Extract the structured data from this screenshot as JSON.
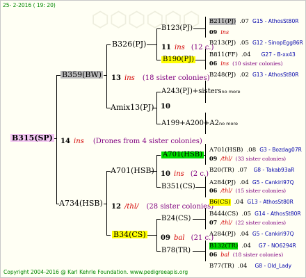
{
  "header": {
    "date": "25- 2-2016 ( 19: 20)"
  },
  "footer": {
    "text": "Copyright 2004-2016 @ Karl Kehrle Foundation.   www.pedigreeapis.org"
  },
  "root": {
    "name": "B315(SP)",
    "num": "14",
    "ins": "ins",
    "drones": "(Drones from 4 sister colonies)"
  },
  "g1": {
    "upper": {
      "name": "B359(BW)",
      "num": "13",
      "ins": "ins",
      "sis": "(18 sister colonies)"
    },
    "lower": {
      "name": "A734(HSB)",
      "num": "12",
      "ins": "/thl/",
      "sis": "(28 sister colonies)"
    }
  },
  "g2": {
    "b326": {
      "name": "B326(PJ)",
      "num": "11",
      "ins": "ins",
      "sis": "(12 c.)"
    },
    "amix": {
      "name": "Amix13(PJ)",
      "num": "10"
    },
    "a701": {
      "name": "A701(HSB)",
      "num": "10",
      "ins": "ins",
      "sis": "(2 c.)"
    },
    "b34": {
      "name": "B34(CS)",
      "num": "09",
      "ins": "bal",
      "sis": "(21 c.)"
    }
  },
  "g3": {
    "b123": {
      "name": "B123(PJ)",
      "num": "09",
      "ins": "ins"
    },
    "b190": {
      "name": "B190(PJ)",
      "num": "06",
      "ins": "ins",
      "sis": "(10 sister colonies)"
    },
    "a243": {
      "name": "A243(PJ)+sisters",
      "nomore": "no more"
    },
    "a199": {
      "name": "A199+A200+A2",
      "nomore": "no more"
    },
    "a701b": {
      "name": "A701(HSB)",
      "num": "09",
      "ins": "/thl/",
      "sis": "(33 sister colonies)"
    },
    "b351": {
      "name": "B351(CS)",
      "num": "06",
      "ins": "/thl/",
      "sis": "(15 sister colonies)"
    },
    "b24": {
      "name": "B24(CS)",
      "num": "07",
      "ins": "/thl/",
      "sis": "(22 sister colonies)"
    },
    "b78": {
      "name": "B78(TR)",
      "num": "06",
      "ins": "bal",
      "sis": "(18 sister colonies)"
    }
  },
  "g4": [
    {
      "name": "B211(PJ)",
      "year": ".07",
      "code": "G15 - AthosSt80R"
    },
    {
      "name": "B213(PJ)",
      "year": ".05",
      "code": "G12 - SinopEgg86R"
    },
    {
      "name": "B811(FF)",
      "year": ".04",
      "code": "G27 - B-xx43"
    },
    {
      "name": "B248(PJ)",
      "year": ".02",
      "code": "G13 - AthosSt80R"
    },
    {
      "name": "A701(HSB)",
      "year": ".08",
      "code": "G3 - Bozdag07R"
    },
    {
      "name": "B20(TR)",
      "year": ".07",
      "code": "G8 - Takab93aR"
    },
    {
      "name": "A284(PJ)",
      "year": ".04",
      "code": "G5 - Cankiri97Q"
    },
    {
      "name": "B6(CS)",
      "year": ".04",
      "code": "G13 - AthosSt80R"
    },
    {
      "name": "B444(CS)",
      "year": ".05",
      "code": "G14 - AthosSt80R"
    },
    {
      "name": "A284(PJ)",
      "year": ".04",
      "code": "G5 - Cankiri97Q"
    },
    {
      "name": "B132(TR)",
      "year": ".04",
      "code": "G7 - NO6294R"
    },
    {
      "name": "B77(TR)",
      "year": ".04",
      "code": "G8 - Old_Lady"
    }
  ]
}
